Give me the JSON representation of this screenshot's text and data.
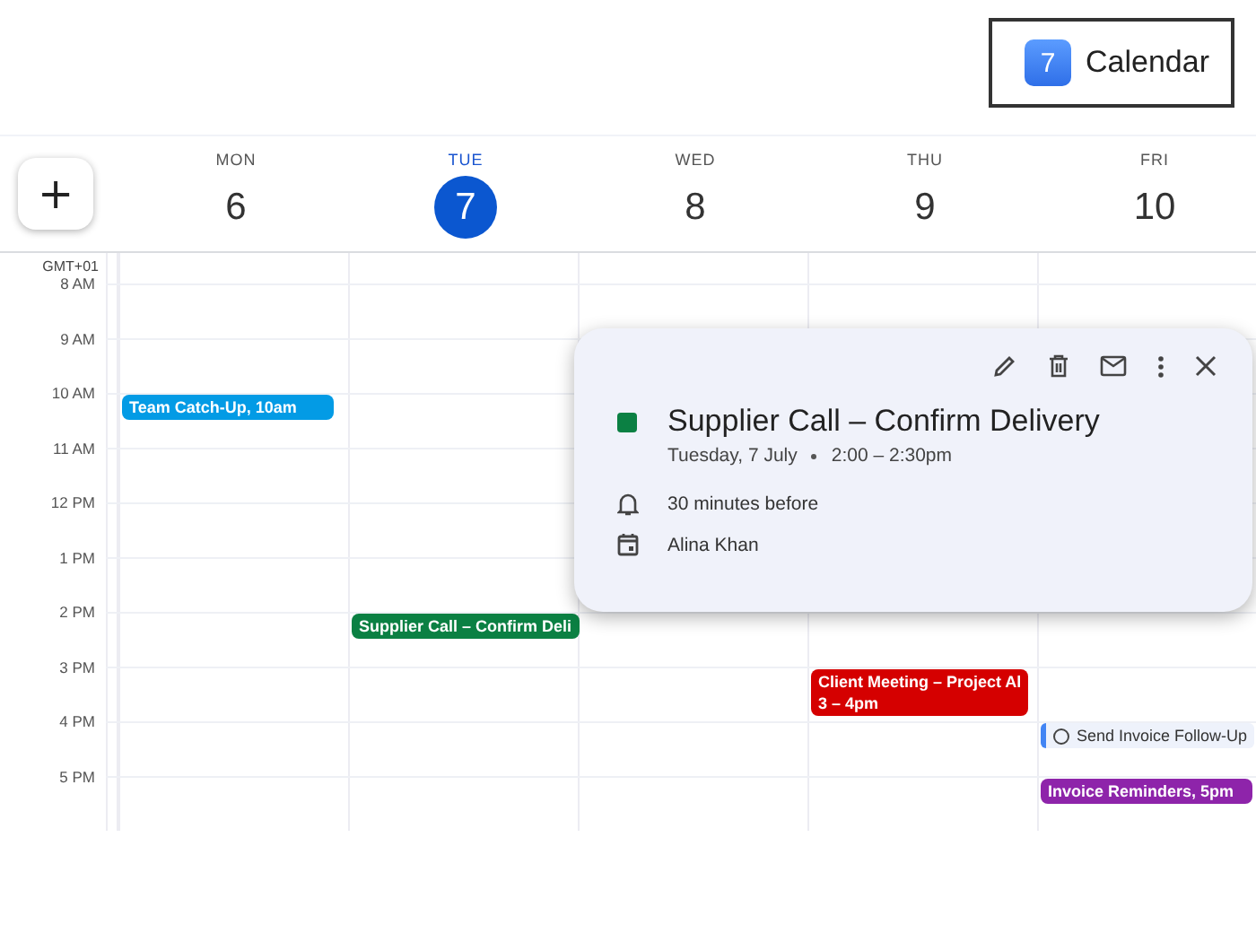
{
  "badge": {
    "icon_number": "7",
    "label": "Calendar"
  },
  "create_button": {
    "label": "+"
  },
  "days": [
    {
      "name": "MON",
      "number": "6",
      "selected": false
    },
    {
      "name": "TUE",
      "number": "7",
      "selected": true
    },
    {
      "name": "WED",
      "number": "8",
      "selected": false
    },
    {
      "name": "THU",
      "number": "9",
      "selected": false
    },
    {
      "name": "FRI",
      "number": "10",
      "selected": false
    }
  ],
  "timezone": "GMT+01",
  "hours": [
    {
      "label": "8 AM"
    },
    {
      "label": "9 AM"
    },
    {
      "label": "10 AM",
      "cells": [
        {
          "events": [
            {
              "kind": "event",
              "title": "Team Catch-Up, 10am",
              "color": "#039be5"
            }
          ]
        }
      ]
    },
    {
      "label": "11 AM"
    },
    {
      "label": "12 PM"
    },
    {
      "label": "1 PM"
    },
    {
      "label": "2 PM",
      "cells": [
        {},
        {
          "events": [
            {
              "kind": "event",
              "title": "Supplier Call – Confirm Deli",
              "color": "#0b8043"
            }
          ]
        }
      ]
    },
    {
      "label": "3 PM",
      "cells": [
        {},
        {},
        {},
        {
          "events": [
            {
              "kind": "event",
              "title": "Client Meeting – Project Al",
              "time": "3 – 4pm",
              "color": "#d50000"
            }
          ]
        }
      ]
    },
    {
      "label": "4 PM",
      "cells": [
        {},
        {},
        {},
        {},
        {
          "events": [
            {
              "kind": "task",
              "title": "Send Invoice Follow-Up",
              "color": "#4285f4"
            }
          ]
        }
      ]
    },
    {
      "label": "5 PM",
      "cells": [
        {},
        {},
        {},
        {},
        {
          "events": [
            {
              "kind": "event",
              "title": "Invoice Reminders, 5pm",
              "color": "#8e24aa"
            }
          ]
        }
      ]
    }
  ],
  "popup": {
    "title": "Supplier Call – Confirm Delivery",
    "color": "#0b8043",
    "date": "Tuesday, 7 July",
    "time": "2:00 – 2:30pm",
    "details": [
      {
        "kind": "reminder",
        "text": "30 minutes before"
      },
      {
        "kind": "calendar",
        "text": "Alina Khan"
      }
    ]
  }
}
